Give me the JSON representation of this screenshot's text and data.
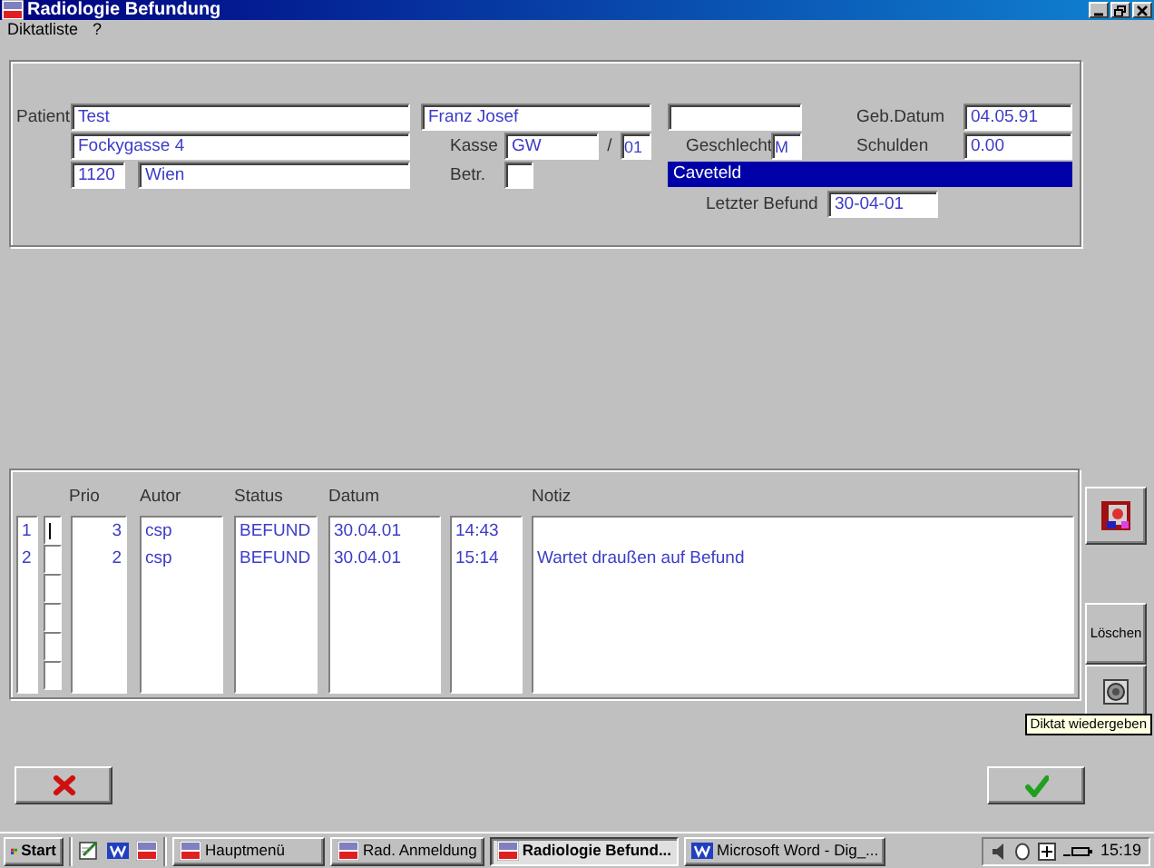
{
  "window": {
    "title": "Radiologie Befundung"
  },
  "menu": [
    "Diktatliste",
    "?"
  ],
  "patient": {
    "label": "Patient",
    "last_name": "Test",
    "first_name": "Franz Josef",
    "street": "Fockygasse 4",
    "zip": "1120",
    "city": "Wien",
    "kasse_label": "Kasse",
    "kasse": "GW",
    "separator": "/",
    "kasse_number": "01",
    "betr_label": "Betr.",
    "geschlecht_label": "Geschlecht",
    "geschlecht": "M",
    "geb_datum_label": "Geb.Datum",
    "geb_datum": "04.05.91",
    "schulden_label": "Schulden",
    "schulden": "0.00",
    "banner": "Caveteld",
    "letzter_befund_label": "Letzter Befund",
    "letzter_befund": "30-04-01"
  },
  "table": {
    "columns": {
      "prio": "Prio",
      "autor": "Autor",
      "status": "Status",
      "datum": "Datum",
      "notiz": "Notiz"
    },
    "rows": [
      {
        "number": "1",
        "selected": true,
        "prio": "3",
        "autor": "csp",
        "status": "BEFUND",
        "datum": "30.04.01",
        "time": "14:43"
      },
      {
        "number": "2",
        "selected": false,
        "prio": "2",
        "autor": "csp",
        "status": "BEFUND",
        "datum": "30.04.01",
        "time": "15:14",
        "notiz": "Wartet draußen auf Befund"
      }
    ]
  },
  "side_buttons": [
    {
      "kind": "picture"
    },
    {
      "kind": "text",
      "label": "Löschen"
    },
    {
      "kind": "speaker"
    }
  ],
  "tooltip": "Diktat wiedergeben",
  "dialog_buttons": [
    {
      "kind": "cancel"
    },
    {
      "kind": "ok"
    }
  ],
  "taskbar": {
    "start": "Start",
    "quick_launch": [
      {
        "kind": "notepad"
      },
      {
        "kind": "word"
      },
      {
        "kind": "csp"
      }
    ],
    "tasks": [
      {
        "label": "Hauptmenü",
        "kind": "csp",
        "selected": false
      },
      {
        "label": "Rad. Anmeldung",
        "kind": "csp",
        "selected": false
      },
      {
        "label": "Radiologie Befund...",
        "kind": "csp",
        "selected": true
      },
      {
        "label": "Microsoft Word - Dig_...",
        "kind": "word",
        "selected": false
      }
    ],
    "clock": "15:19"
  }
}
